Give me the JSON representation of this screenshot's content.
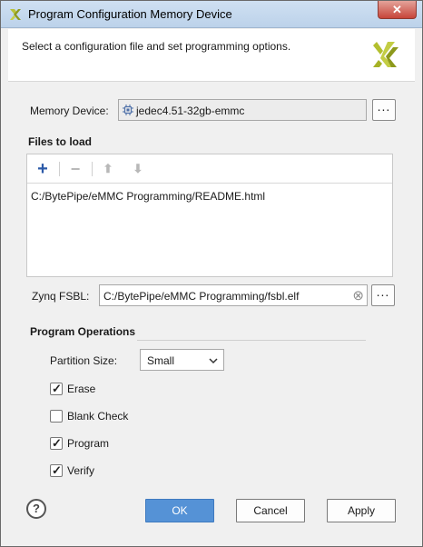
{
  "window": {
    "title": "Program Configuration Memory Device",
    "close_glyph": "✕"
  },
  "header": {
    "instruction": "Select a configuration file and set programming options."
  },
  "memory_device": {
    "label": "Memory Device:",
    "value": "jedec4.51-32gb-emmc",
    "browse_glyph": "..."
  },
  "files": {
    "section_title": "Files to load",
    "toolbar": {
      "add_glyph": "+",
      "remove_glyph": "−",
      "up_glyph": "⬆",
      "down_glyph": "⬇"
    },
    "items": [
      "C:/BytePipe/eMMC Programming/README.html"
    ]
  },
  "fsbl": {
    "label": "Zynq FSBL:",
    "value": "C:/BytePipe/eMMC Programming/fsbl.elf",
    "clear_glyph": "⊗",
    "browse_glyph": "..."
  },
  "operations": {
    "section_title": "Program Operations",
    "partition_label": "Partition Size:",
    "partition_value": "Small",
    "options": [
      {
        "label": "Erase",
        "checked": true
      },
      {
        "label": "Blank Check",
        "checked": false
      },
      {
        "label": "Program",
        "checked": true
      },
      {
        "label": "Verify",
        "checked": true
      }
    ]
  },
  "buttons": {
    "help": "?",
    "ok": "OK",
    "cancel": "Cancel",
    "apply": "Apply"
  },
  "colors": {
    "primary_button": "#5592d6",
    "logo": "#a7b52a"
  },
  "icons": {
    "title": "xilinx-logo-icon",
    "header_logo": "xilinx-logo-icon",
    "device_chip": "chip-icon"
  }
}
